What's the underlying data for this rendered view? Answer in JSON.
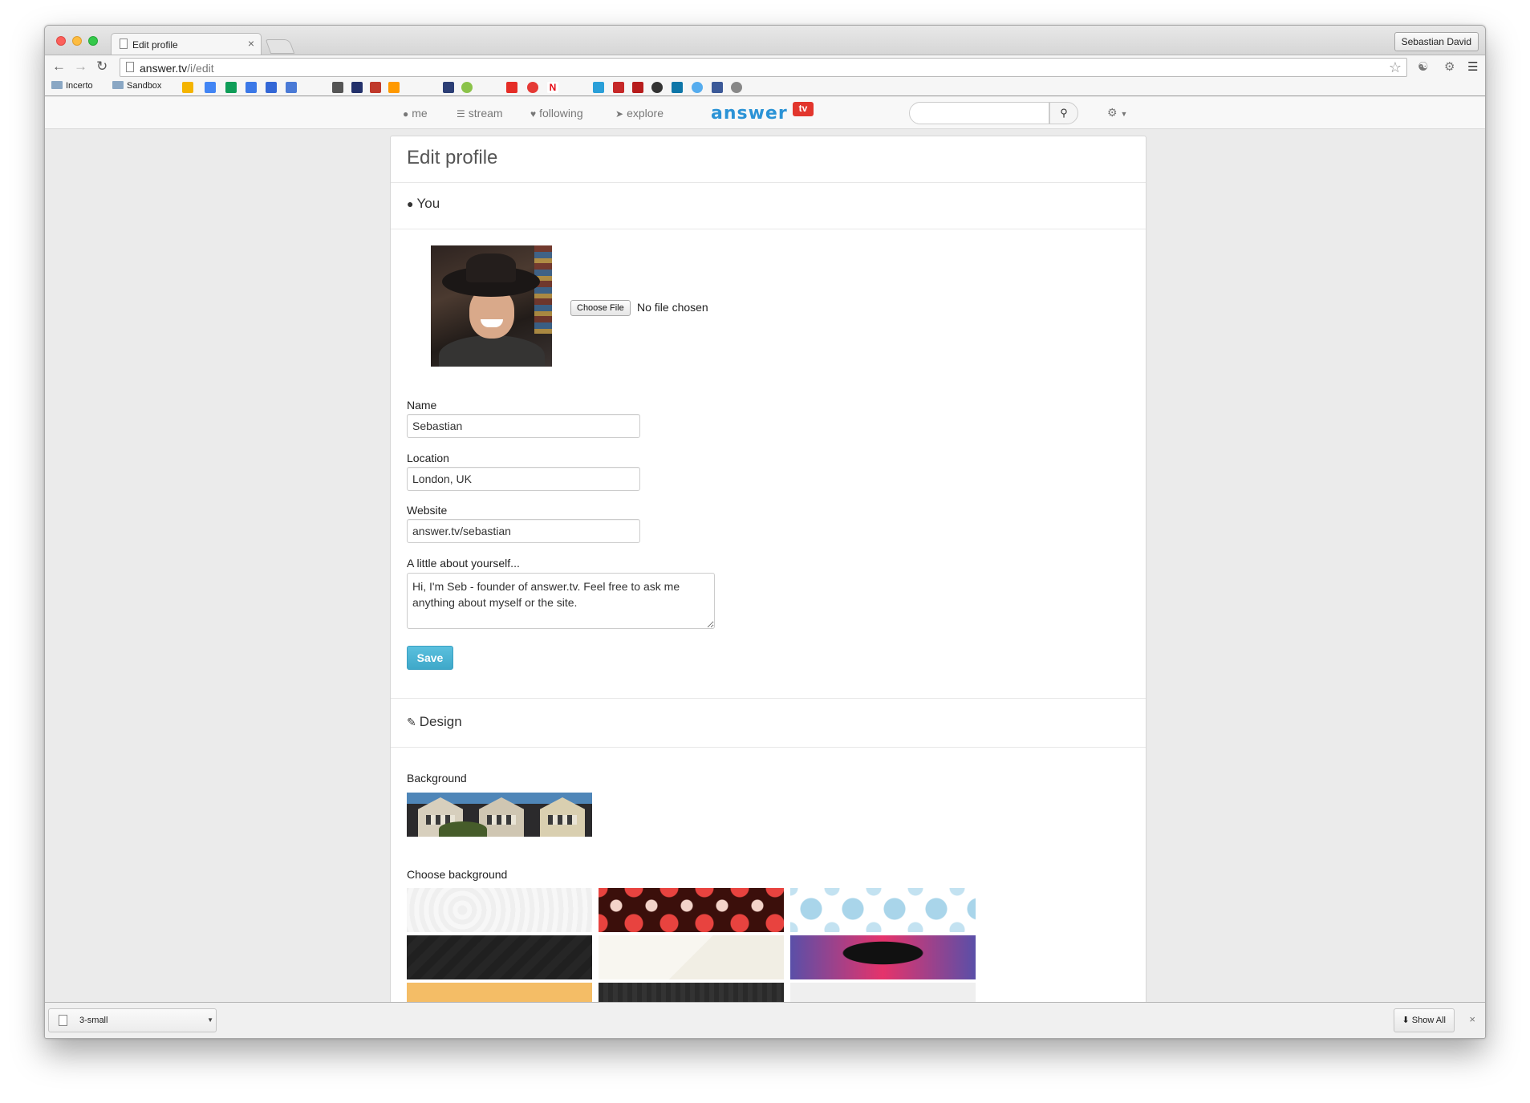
{
  "browser": {
    "tab_title": "Edit profile",
    "profile_name": "Sebastian David",
    "url_host": "answer.tv",
    "url_path": "/i/edit",
    "bookmarks": [
      {
        "label": "Incerto"
      },
      {
        "label": "Sandbox"
      }
    ],
    "download": {
      "file": "3-small",
      "show_all": "Show All"
    }
  },
  "nav": {
    "items": [
      "me",
      "stream",
      "following",
      "explore"
    ],
    "logo_word": "answer",
    "logo_badge": "tv",
    "search_placeholder": ""
  },
  "page": {
    "title": "Edit profile",
    "you_heading": "You",
    "file_button": "Choose File",
    "file_status": "No file chosen",
    "fields": {
      "name_label": "Name",
      "name_value": "Sebastian",
      "location_label": "Location",
      "location_value": "London, UK",
      "website_label": "Website",
      "website_value": "answer.tv/sebastian",
      "about_label": "A little about yourself...",
      "about_value": "Hi, I'm Seb - founder of answer.tv. Feel free to ask me anything about myself or the site."
    },
    "save_label": "Save",
    "design_heading": "Design",
    "background_label": "Background",
    "choose_background_label": "Choose background"
  },
  "colors": {
    "accent": "#5bc0de",
    "logo": "#2b93d6",
    "logo_badge": "#e2362d"
  }
}
